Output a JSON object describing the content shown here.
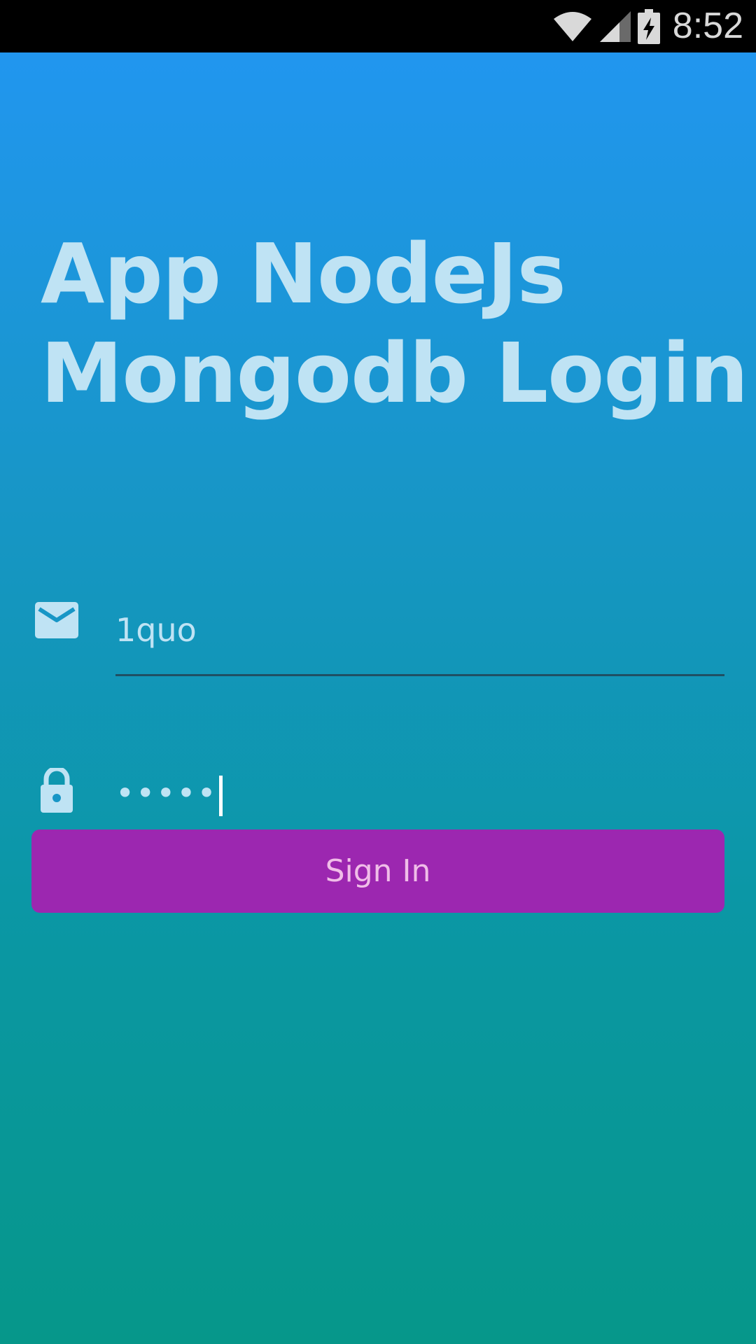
{
  "status_bar": {
    "time": "8:52",
    "icons": [
      "wifi-icon",
      "cell-signal-icon",
      "battery-charging-icon"
    ]
  },
  "login": {
    "title_line1": "App NodeJs",
    "title_line2": "Mongodb Login",
    "email_value": "1quo",
    "password_value": "•••••",
    "sign_in_label": "Sign In"
  },
  "colors": {
    "gradient_top": "#2196ef",
    "gradient_bottom": "#06978a",
    "button": "#9c27b0",
    "text_light": "#bfe3f4",
    "focus_underline": "#2196f3"
  }
}
